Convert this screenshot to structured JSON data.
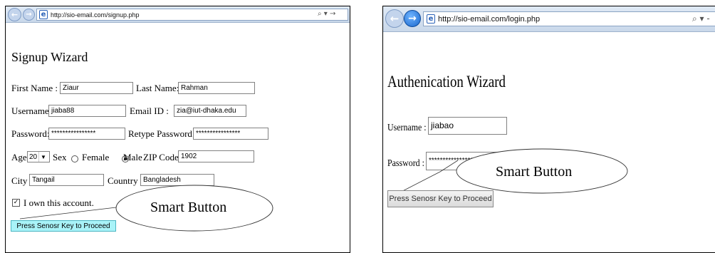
{
  "signup_window": {
    "address": {
      "url": "http://sio-email.com/signup.php",
      "tools": "⌕ ▾ →"
    },
    "heading": "Signup Wizard",
    "first_name": {
      "label": "First Name :",
      "value": "Ziaur"
    },
    "last_name": {
      "label": "Last Name:",
      "value": "Rahman"
    },
    "username": {
      "label": "Username:",
      "value": "jiaba88"
    },
    "email": {
      "label": "Email ID :",
      "value": "zia@iut-dhaka.edu"
    },
    "password": {
      "label": "Password:",
      "value": "****************"
    },
    "retype_password": {
      "label": "Retype Password:",
      "value": "****************"
    },
    "age": {
      "label": "Age",
      "value": "20"
    },
    "sex": {
      "label": "Sex",
      "female_label": "Female",
      "male_label": "Male",
      "selected": "Male"
    },
    "zip": {
      "label": "ZIP Code",
      "value": "1902"
    },
    "city": {
      "label": "City",
      "value": "Tangail"
    },
    "country": {
      "label": "Country",
      "value": "Bangladesh"
    },
    "own_account": {
      "label": "I own this account.",
      "checked": true
    },
    "proceed_button": "Press Senosr Key to Proceed",
    "callout": "Smart Button"
  },
  "auth_window": {
    "address": {
      "url": "http://sio-email.com/login.php",
      "tools": "⌕ ▾ -"
    },
    "heading": "Authenication Wizard",
    "username": {
      "label": "Username :",
      "value": "jiabao"
    },
    "password": {
      "label": "Password :",
      "value": "******************"
    },
    "proceed_button": "Press Senosr Key to Proceed",
    "callout": "Smart Button"
  },
  "icons": {
    "back": "back-arrow-icon",
    "forward": "forward-arrow-icon",
    "page": "ie-page-icon",
    "search": "search-icon",
    "dropdown": "chevron-down-icon",
    "go": "go-arrow-icon"
  },
  "colors": {
    "proceed_button_bg": "#a9f3f8",
    "nav_blue": "#1966cc"
  }
}
